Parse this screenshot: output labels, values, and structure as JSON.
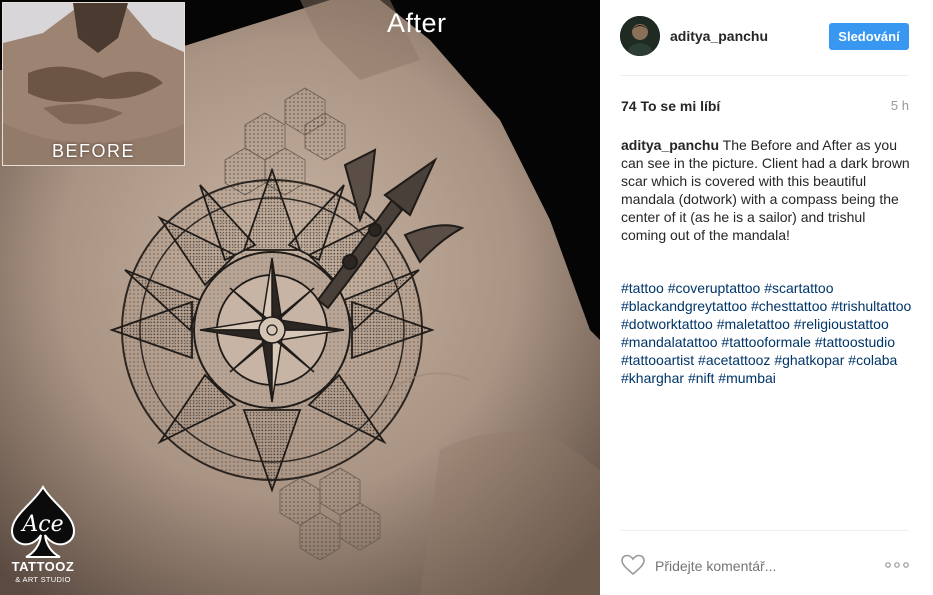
{
  "photo": {
    "after_label": "After",
    "before_label": "BEFORE",
    "logo": {
      "script_text": "Ace",
      "main_text": "TATTOOZ",
      "sub_text": "& ART STUDIO"
    }
  },
  "header": {
    "username": "aditya_panchu",
    "follow_button": "Sledování",
    "avatar_icon": "user-avatar"
  },
  "post": {
    "likes": "74 To se mi líbí",
    "time": "5 h",
    "caption_user": "aditya_panchu",
    "caption_text": " The Before and After as you can see in the picture. Client had a dark brown scar which is covered with this beautiful mandala (dotwork) with a compass being the center of it (as he is a sailor) and trishul coming out of the mandala!",
    "hashtags": [
      "#tattoo",
      "#coveruptattoo",
      "#scartattoo",
      "#blackandgreytattoo",
      "#chesttattoo",
      "#trishultattoo",
      "#dotworktattoo",
      "#maletattoo",
      "#religioustattoo",
      "#mandalatattoo",
      "#tattooformale",
      "#tattoostudio",
      "#tattooartist",
      "#acetattooz",
      "#ghatkopar",
      "#colaba",
      "#kharghar",
      "#nift",
      "#mumbai"
    ]
  },
  "footer": {
    "comment_placeholder": "Přidejte komentář...",
    "like_icon": "heart-outline",
    "more_icon": "more-options"
  },
  "colors": {
    "accent": "#3897f0",
    "hashtag": "#003569",
    "muted": "#999999",
    "text": "#262626"
  }
}
